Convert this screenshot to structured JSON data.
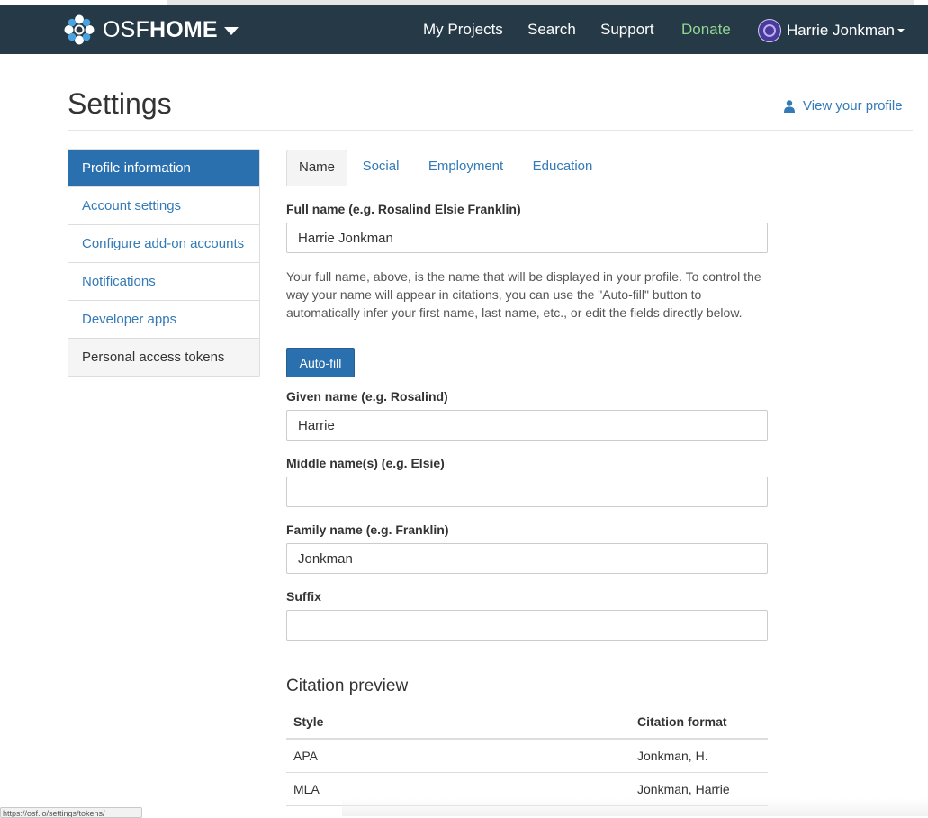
{
  "navbar": {
    "brand_osf": "OSF",
    "brand_home": "HOME",
    "links": {
      "my_projects": "My Projects",
      "search": "Search",
      "support": "Support",
      "donate": "Donate"
    },
    "user_name": "Harrie Jonkman",
    "colors": {
      "background": "#263947",
      "donate": "#91d591"
    }
  },
  "page": {
    "title": "Settings",
    "view_profile": "View your profile"
  },
  "sidebar": {
    "items": [
      {
        "label": "Profile information"
      },
      {
        "label": "Account settings"
      },
      {
        "label": "Configure add-on accounts"
      },
      {
        "label": "Notifications"
      },
      {
        "label": "Developer apps"
      },
      {
        "label": "Personal access tokens"
      }
    ]
  },
  "tabs": {
    "items": [
      {
        "label": "Name"
      },
      {
        "label": "Social"
      },
      {
        "label": "Employment"
      },
      {
        "label": "Education"
      }
    ]
  },
  "form": {
    "full_name_label": "Full name (e.g. Rosalind Elsie Franklin)",
    "full_name_value": "Harrie Jonkman",
    "help_text": "Your full name, above, is the name that will be displayed in your profile. To control the way your name will appear in citations, you can use the \"Auto-fill\" button to automatically infer your first name, last name, etc., or edit the fields directly below.",
    "autofill_label": "Auto-fill",
    "given_label": "Given name (e.g. Rosalind)",
    "given_value": "Harrie",
    "middle_label": "Middle name(s) (e.g. Elsie)",
    "middle_value": "",
    "family_label": "Family name (e.g. Franklin)",
    "family_value": "Jonkman",
    "suffix_label": "Suffix",
    "suffix_value": ""
  },
  "citation": {
    "title": "Citation preview",
    "headers": {
      "style": "Style",
      "format": "Citation format"
    },
    "rows": [
      {
        "style": "APA",
        "format": "Jonkman, H."
      },
      {
        "style": "MLA",
        "format": "Jonkman, Harrie"
      }
    ]
  },
  "status_bar": {
    "url": "https://osf.io/settings/tokens/"
  },
  "colors": {
    "accent": "#337ab7",
    "active_bg": "#2a70ae"
  }
}
